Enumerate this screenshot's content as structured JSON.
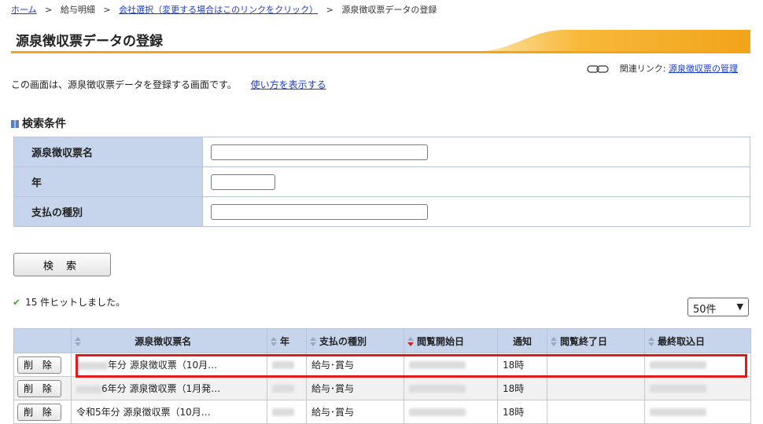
{
  "breadcrumb": {
    "home": "ホーム",
    "payslip": "給与明細",
    "company_select": "会社選択（変更する場合はこのリンクをクリック）",
    "current": "源泉徴収票データの登録"
  },
  "page_title": "源泉徴収票データの登録",
  "related": {
    "prefix": "関連リンク:",
    "link": "源泉徴収票の管理"
  },
  "intro": {
    "text": "この画面は、源泉徴収票データを登録する画面です。",
    "howto_link": "使い方を表示する"
  },
  "search_section": {
    "heading": "検索条件",
    "fields": [
      {
        "label": "源泉徴収票名",
        "value": ""
      },
      {
        "label": "年",
        "value": ""
      },
      {
        "label": "支払の種別",
        "value": ""
      }
    ],
    "button": "検 索"
  },
  "results": {
    "hits": "15 件ヒットしました。",
    "page_size": "50件",
    "columns": [
      "源泉徴収票名",
      "年",
      "支払の種別",
      "閲覧開始日",
      "通知",
      "閲覧終了日",
      "最終取込日"
    ],
    "rows": [
      {
        "delete": "削 除",
        "name": "年分 源泉徴収票（10月…",
        "type": "給与･賞与",
        "notice": "18時"
      },
      {
        "delete": "削 除",
        "name": "6年分 源泉徴収票（1月発…",
        "type": "給与･賞与",
        "notice": "18時"
      },
      {
        "delete": "削 除",
        "name": "令和5年分 源泉徴収票（10月…",
        "type": "給与･賞与",
        "notice": "18時"
      }
    ]
  },
  "colors": {
    "header_bg": "#c7d5ec",
    "accent_orange": "#f2a41a",
    "highlight_red": "#e11b1b",
    "link_blue": "#1a3ccc"
  }
}
